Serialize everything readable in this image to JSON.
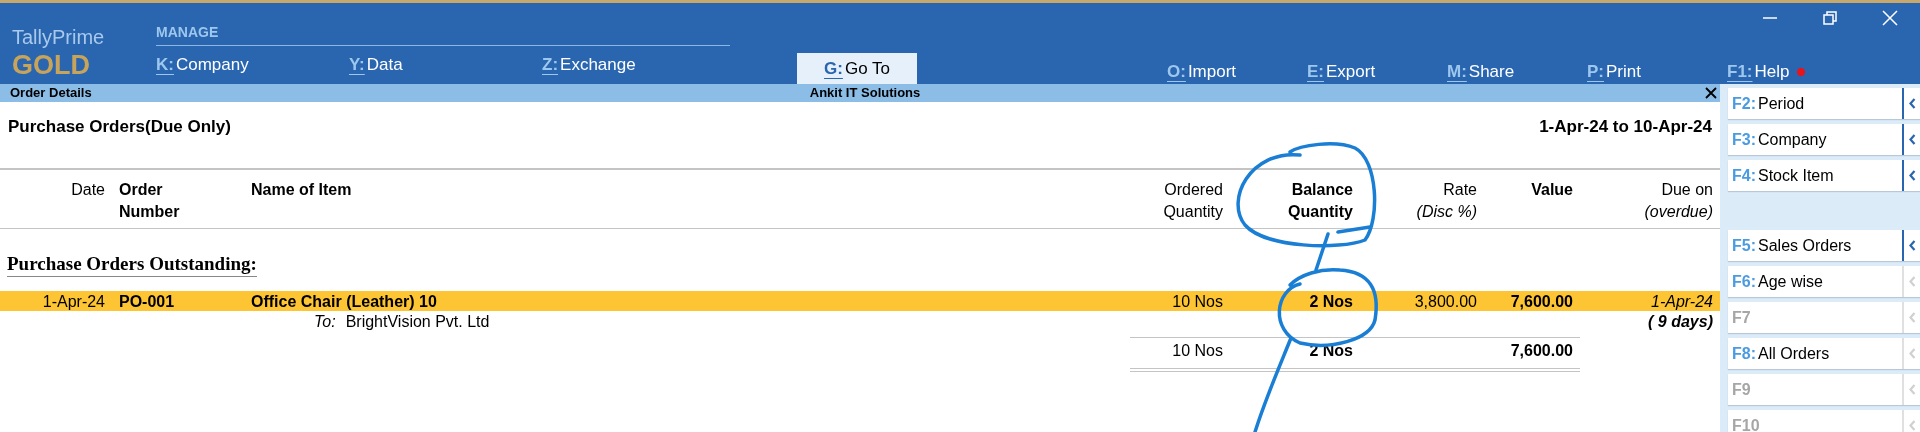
{
  "app": {
    "brand": "TallyPrime",
    "edition": "GOLD"
  },
  "menu": {
    "section": "MANAGE",
    "manage_items": [
      {
        "key": "K:",
        "label": "Company"
      },
      {
        "key": "Y:",
        "label": "Data"
      },
      {
        "key": "Z:",
        "label": "Exchange"
      }
    ],
    "goto": {
      "key": "G:",
      "label": "Go To"
    },
    "actions": [
      {
        "key": "O:",
        "label": "Import",
        "notification": false
      },
      {
        "key": "E:",
        "label": "Export",
        "notification": false
      },
      {
        "key": "M:",
        "label": "Share",
        "notification": false
      },
      {
        "key": "P:",
        "label": "Print",
        "notification": false
      },
      {
        "key": "F1:",
        "label": "Help",
        "notification": true
      }
    ]
  },
  "report_bar": {
    "title": "Order Details",
    "company": "Ankit IT Solutions"
  },
  "report": {
    "title": "Purchase Orders(Due Only)",
    "period": "1-Apr-24 to 10-Apr-24",
    "columns": [
      {
        "lines": [
          "Date"
        ],
        "bold": false
      },
      {
        "lines": [
          "Order",
          "Number"
        ],
        "bold": true,
        "italic_second": false
      },
      {
        "lines": [
          "Name of Item"
        ],
        "bold": true
      },
      {
        "lines": [
          "Ordered",
          "Quantity"
        ],
        "bold": false,
        "italic_second": false
      },
      {
        "lines": [
          "Balance",
          "Quantity"
        ],
        "bold": true,
        "italic_second": false
      },
      {
        "lines": [
          "Rate",
          "(Disc %)"
        ],
        "bold": false,
        "italic_second": true
      },
      {
        "lines": [
          "Value"
        ],
        "bold": true
      },
      {
        "lines": [
          "Due on",
          "(overdue)"
        ],
        "bold": false,
        "italic_second": true
      }
    ],
    "section": "Purchase Orders Outstanding:",
    "rows": [
      {
        "date": "1-Apr-24",
        "order_number": "PO-001",
        "item": "Office Chair (Leather) 10",
        "ordered": "10 Nos",
        "balance": "2 Nos",
        "rate": "3,800.00",
        "value": "7,600.00",
        "due_on": "1-Apr-24",
        "overdue": "( 9 days)",
        "party_prefix": "To:",
        "party": "BrightVision Pvt. Ltd",
        "selected": true
      }
    ],
    "totals": {
      "ordered": "10 Nos",
      "balance": "2 Nos",
      "value": "7,600.00"
    }
  },
  "sidebar": {
    "groups": [
      [
        {
          "key": "F2:",
          "label": "Period",
          "disabled": false,
          "chevron_active": true
        },
        {
          "key": "F3:",
          "label": "Company",
          "disabled": false,
          "chevron_active": true
        },
        {
          "key": "F4:",
          "label": "Stock Item",
          "disabled": false,
          "chevron_active": true
        }
      ],
      [
        {
          "key": "F5:",
          "label": "Sales Orders",
          "disabled": false,
          "chevron_active": true
        },
        {
          "key": "F6:",
          "label": "Age wise",
          "disabled": false,
          "chevron_active": false
        },
        {
          "key": "F7",
          "disabled": true,
          "chevron_active": false
        },
        {
          "key": "F8:",
          "label": "All Orders",
          "disabled": false,
          "chevron_active": false
        },
        {
          "key": "F9",
          "disabled": true,
          "chevron_active": false
        },
        {
          "key": "F10",
          "disabled": true,
          "chevron_active": false
        }
      ]
    ]
  }
}
